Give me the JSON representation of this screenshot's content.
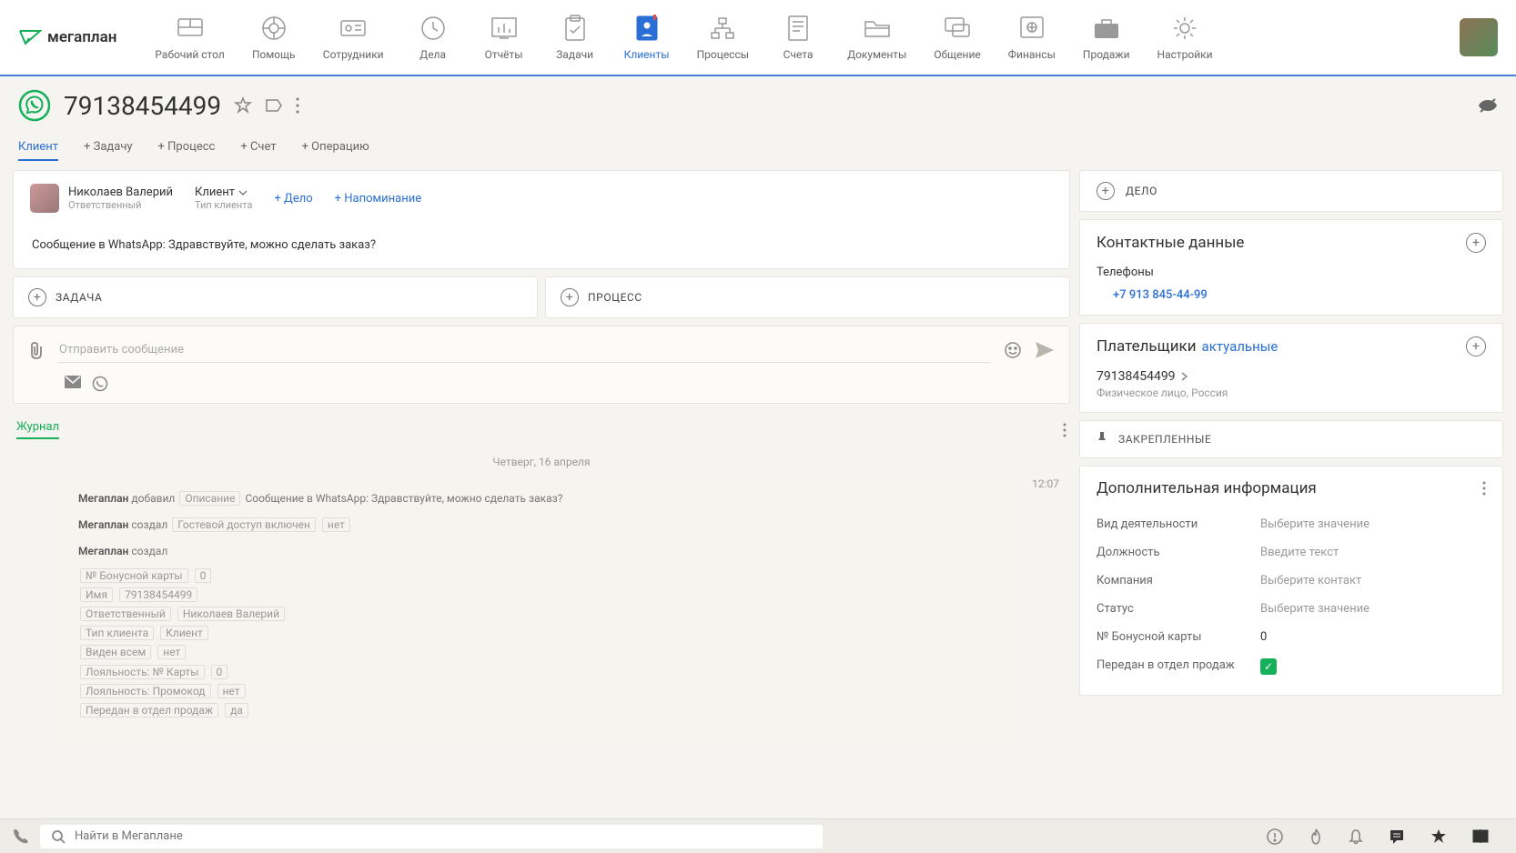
{
  "nav": {
    "items": [
      {
        "label": "Рабочий стол"
      },
      {
        "label": "Помощь"
      },
      {
        "label": "Сотрудники"
      },
      {
        "label": "Дела"
      },
      {
        "label": "Отчёты"
      },
      {
        "label": "Задачи"
      },
      {
        "label": "Клиенты"
      },
      {
        "label": "Процессы"
      },
      {
        "label": "Счета"
      },
      {
        "label": "Документы"
      },
      {
        "label": "Общение"
      },
      {
        "label": "Финансы"
      },
      {
        "label": "Продажи"
      },
      {
        "label": "Настройки"
      }
    ]
  },
  "title": "79138454499",
  "tabs": {
    "client": "Клиент",
    "task": "+ Задачу",
    "process": "+ Процесс",
    "account": "+ Счет",
    "operation": "+ Операцию"
  },
  "owner": {
    "name": "Николаев Валерий",
    "role": "Ответственный",
    "clientTypeValue": "Клиент",
    "clientTypeLabel": "Тип клиента",
    "addDeal": "+ Дело",
    "addReminder": "+ Напоминание"
  },
  "whatsappMsg": "Сообщение в WhatsApp: Здравствуйте, можно сделать заказ?",
  "buttons": {
    "task": "ЗАДАЧА",
    "process": "ПРОЦЕСС",
    "deal": "ДЕЛО"
  },
  "compose": {
    "placeholder": "Отправить сообщение"
  },
  "journal": {
    "label": "Журнал",
    "date": "Четверг, 16 апреля",
    "time": "12:07",
    "e1_author": "Мегаплан",
    "e1_action": "добавил",
    "e1_field": "Описание",
    "e1_value": "Сообщение в WhatsApp: Здравствуйте, можно сделать заказ?",
    "e2_author": "Мегаплан",
    "e2_action": "создал",
    "e2_field": "Гостевой доступ включен",
    "e2_value": "нет",
    "e3_author": "Мегаплан",
    "e3_action": "создал",
    "fields": {
      "f0_k": "№ Бонусной карты",
      "f0_v": "0",
      "f1_k": "Имя",
      "f1_v": "79138454499",
      "f2_k": "Ответственный",
      "f2_v": "Николаев Валерий",
      "f3_k": "Тип клиента",
      "f3_v": "Клиент",
      "f4_k": "Виден всем",
      "f4_v": "нет",
      "f5_k": "Лояльность: № Карты",
      "f5_v": "0",
      "f6_k": "Лояльность: Промокод",
      "f6_v": "нет",
      "f7_k": "Передан в отдел продаж",
      "f7_v": "да"
    }
  },
  "side": {
    "contacts": "Контактные данные",
    "phonesLabel": "Телефоны",
    "phone": "+7 913 845-44-99",
    "payersTitle": "Плательщики",
    "payersMode": "актуальные",
    "payerName": "79138454499",
    "payerSub": "Физическое лицо, Россия",
    "pinned": "ЗАКРЕПЛЕННЫЕ",
    "extraTitle": "Дополнительная информация",
    "rows": {
      "r0_k": "Вид деятельности",
      "r0_v": "Выберите значение",
      "r1_k": "Должность",
      "r1_v": "Введите текст",
      "r2_k": "Компания",
      "r2_v": "Выберите контакт",
      "r3_k": "Статус",
      "r3_v": "Выберите значение",
      "r4_k": "№ Бонусной карты",
      "r4_v": "0",
      "r5_k": "Передан в отдел продаж"
    }
  },
  "search": {
    "placeholder": "Найти в Мегаплане"
  }
}
